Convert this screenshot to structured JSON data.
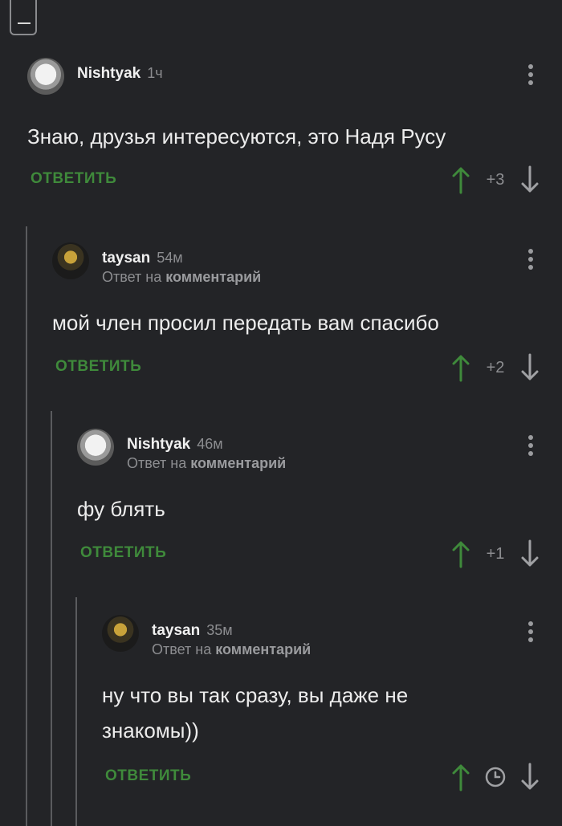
{
  "comments": [
    {
      "username": "Nishtyak",
      "time": "1ч",
      "reply_prefix": "",
      "reply_target": "",
      "text": "Знаю, друзья интересуются, это Надя Русу",
      "reply_label": "ОТВЕТИТЬ",
      "score": "+3"
    },
    {
      "username": "taysan",
      "time": "54м",
      "reply_prefix": "Ответ на ",
      "reply_target": "комментарий",
      "text": "мой член просил передать вам спасибо",
      "reply_label": "ОТВЕТИТЬ",
      "score": "+2"
    },
    {
      "username": "Nishtyak",
      "time": "46м",
      "reply_prefix": "Ответ на ",
      "reply_target": "комментарий",
      "text": "фу блять",
      "reply_label": "ОТВЕТИТЬ",
      "score": "+1"
    },
    {
      "username": "taysan",
      "time": "35м",
      "reply_prefix": "Ответ на ",
      "reply_target": "комментарий",
      "text": "ну что вы так сразу, вы даже не знакомы))",
      "reply_label": "ОТВЕТИТЬ",
      "score": ""
    }
  ],
  "colors": {
    "background": "#232427",
    "accent_green": "#3f8a3b",
    "muted": "#8c8d90"
  }
}
